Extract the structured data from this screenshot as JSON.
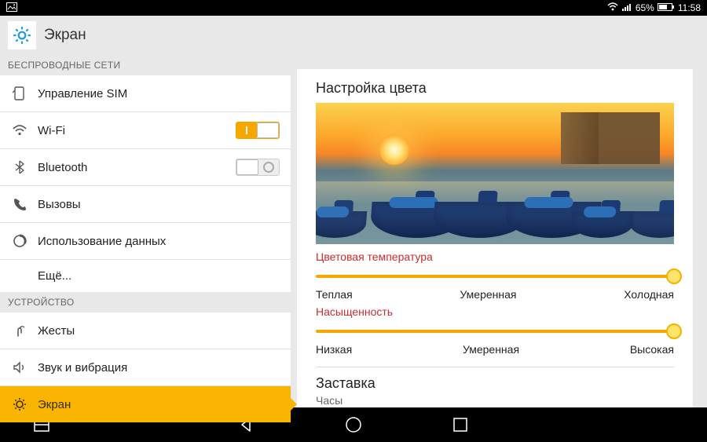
{
  "status_bar": {
    "battery_pct": "65%",
    "time": "11:58"
  },
  "header": {
    "title": "Экран"
  },
  "sidebar": {
    "sections": [
      {
        "header": "БЕСПРОВОДНЫЕ СЕТИ",
        "items": [
          {
            "id": "sim",
            "label": "Управление SIM",
            "icon": "sim-icon"
          },
          {
            "id": "wifi",
            "label": "Wi-Fi",
            "icon": "wifi-icon",
            "toggle": true,
            "on": true
          },
          {
            "id": "bt",
            "label": "Bluetooth",
            "icon": "bluetooth-icon",
            "toggle": true,
            "on": false
          },
          {
            "id": "calls",
            "label": "Вызовы",
            "icon": "phone-icon"
          },
          {
            "id": "data",
            "label": "Использование данных",
            "icon": "data-usage-icon"
          },
          {
            "id": "more",
            "label": "Ещё...",
            "indent": true
          }
        ]
      },
      {
        "header": "УСТРОЙСТВО",
        "items": [
          {
            "id": "gestures",
            "label": "Жесты",
            "icon": "gesture-icon"
          },
          {
            "id": "sound",
            "label": "Звук и вибрация",
            "icon": "sound-icon"
          },
          {
            "id": "display",
            "label": "Экран",
            "icon": "brightness-icon",
            "selected": true
          }
        ]
      }
    ]
  },
  "content": {
    "color_setup_title": "Настройка цвета",
    "sliders": [
      {
        "id": "temperature",
        "label": "Цветовая температура",
        "value": 1.0,
        "marks": [
          "Теплая",
          "Умеренная",
          "Холодная"
        ]
      },
      {
        "id": "saturation",
        "label": "Насыщенность",
        "value": 1.0,
        "marks": [
          "Низкая",
          "Умеренная",
          "Высокая"
        ]
      }
    ],
    "screensaver": {
      "title": "Заставка",
      "value": "Часы"
    }
  },
  "nav": {
    "buttons": [
      "split-icon",
      "back-icon",
      "home-icon",
      "recent-icon"
    ]
  }
}
